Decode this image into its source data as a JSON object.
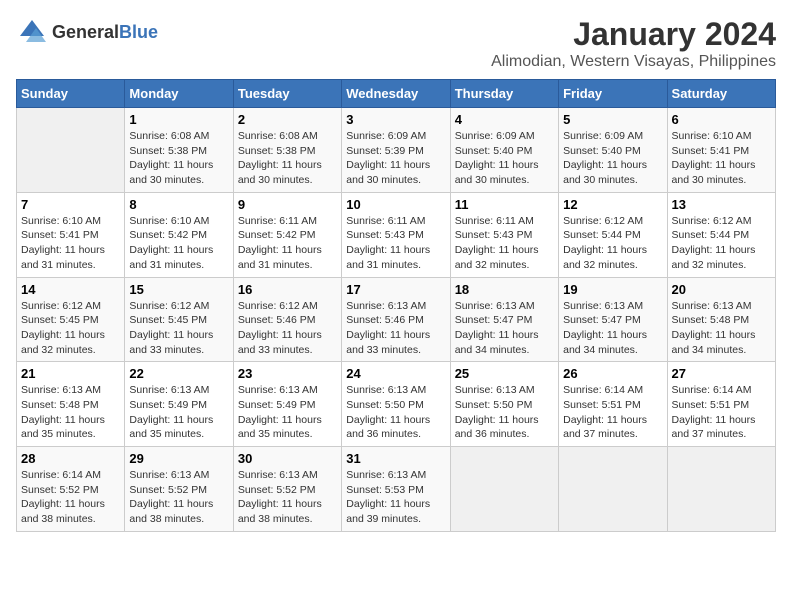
{
  "logo": {
    "general": "General",
    "blue": "Blue"
  },
  "title": "January 2024",
  "subtitle": "Alimodian, Western Visayas, Philippines",
  "days_of_week": [
    "Sunday",
    "Monday",
    "Tuesday",
    "Wednesday",
    "Thursday",
    "Friday",
    "Saturday"
  ],
  "weeks": [
    [
      {
        "day": "",
        "info": ""
      },
      {
        "day": "1",
        "info": "Sunrise: 6:08 AM\nSunset: 5:38 PM\nDaylight: 11 hours\nand 30 minutes."
      },
      {
        "day": "2",
        "info": "Sunrise: 6:08 AM\nSunset: 5:38 PM\nDaylight: 11 hours\nand 30 minutes."
      },
      {
        "day": "3",
        "info": "Sunrise: 6:09 AM\nSunset: 5:39 PM\nDaylight: 11 hours\nand 30 minutes."
      },
      {
        "day": "4",
        "info": "Sunrise: 6:09 AM\nSunset: 5:40 PM\nDaylight: 11 hours\nand 30 minutes."
      },
      {
        "day": "5",
        "info": "Sunrise: 6:09 AM\nSunset: 5:40 PM\nDaylight: 11 hours\nand 30 minutes."
      },
      {
        "day": "6",
        "info": "Sunrise: 6:10 AM\nSunset: 5:41 PM\nDaylight: 11 hours\nand 30 minutes."
      }
    ],
    [
      {
        "day": "7",
        "info": "Sunrise: 6:10 AM\nSunset: 5:41 PM\nDaylight: 11 hours\nand 31 minutes."
      },
      {
        "day": "8",
        "info": "Sunrise: 6:10 AM\nSunset: 5:42 PM\nDaylight: 11 hours\nand 31 minutes."
      },
      {
        "day": "9",
        "info": "Sunrise: 6:11 AM\nSunset: 5:42 PM\nDaylight: 11 hours\nand 31 minutes."
      },
      {
        "day": "10",
        "info": "Sunrise: 6:11 AM\nSunset: 5:43 PM\nDaylight: 11 hours\nand 31 minutes."
      },
      {
        "day": "11",
        "info": "Sunrise: 6:11 AM\nSunset: 5:43 PM\nDaylight: 11 hours\nand 32 minutes."
      },
      {
        "day": "12",
        "info": "Sunrise: 6:12 AM\nSunset: 5:44 PM\nDaylight: 11 hours\nand 32 minutes."
      },
      {
        "day": "13",
        "info": "Sunrise: 6:12 AM\nSunset: 5:44 PM\nDaylight: 11 hours\nand 32 minutes."
      }
    ],
    [
      {
        "day": "14",
        "info": "Sunrise: 6:12 AM\nSunset: 5:45 PM\nDaylight: 11 hours\nand 32 minutes."
      },
      {
        "day": "15",
        "info": "Sunrise: 6:12 AM\nSunset: 5:45 PM\nDaylight: 11 hours\nand 33 minutes."
      },
      {
        "day": "16",
        "info": "Sunrise: 6:12 AM\nSunset: 5:46 PM\nDaylight: 11 hours\nand 33 minutes."
      },
      {
        "day": "17",
        "info": "Sunrise: 6:13 AM\nSunset: 5:46 PM\nDaylight: 11 hours\nand 33 minutes."
      },
      {
        "day": "18",
        "info": "Sunrise: 6:13 AM\nSunset: 5:47 PM\nDaylight: 11 hours\nand 34 minutes."
      },
      {
        "day": "19",
        "info": "Sunrise: 6:13 AM\nSunset: 5:47 PM\nDaylight: 11 hours\nand 34 minutes."
      },
      {
        "day": "20",
        "info": "Sunrise: 6:13 AM\nSunset: 5:48 PM\nDaylight: 11 hours\nand 34 minutes."
      }
    ],
    [
      {
        "day": "21",
        "info": "Sunrise: 6:13 AM\nSunset: 5:48 PM\nDaylight: 11 hours\nand 35 minutes."
      },
      {
        "day": "22",
        "info": "Sunrise: 6:13 AM\nSunset: 5:49 PM\nDaylight: 11 hours\nand 35 minutes."
      },
      {
        "day": "23",
        "info": "Sunrise: 6:13 AM\nSunset: 5:49 PM\nDaylight: 11 hours\nand 35 minutes."
      },
      {
        "day": "24",
        "info": "Sunrise: 6:13 AM\nSunset: 5:50 PM\nDaylight: 11 hours\nand 36 minutes."
      },
      {
        "day": "25",
        "info": "Sunrise: 6:13 AM\nSunset: 5:50 PM\nDaylight: 11 hours\nand 36 minutes."
      },
      {
        "day": "26",
        "info": "Sunrise: 6:14 AM\nSunset: 5:51 PM\nDaylight: 11 hours\nand 37 minutes."
      },
      {
        "day": "27",
        "info": "Sunrise: 6:14 AM\nSunset: 5:51 PM\nDaylight: 11 hours\nand 37 minutes."
      }
    ],
    [
      {
        "day": "28",
        "info": "Sunrise: 6:14 AM\nSunset: 5:52 PM\nDaylight: 11 hours\nand 38 minutes."
      },
      {
        "day": "29",
        "info": "Sunrise: 6:13 AM\nSunset: 5:52 PM\nDaylight: 11 hours\nand 38 minutes."
      },
      {
        "day": "30",
        "info": "Sunrise: 6:13 AM\nSunset: 5:52 PM\nDaylight: 11 hours\nand 38 minutes."
      },
      {
        "day": "31",
        "info": "Sunrise: 6:13 AM\nSunset: 5:53 PM\nDaylight: 11 hours\nand 39 minutes."
      },
      {
        "day": "",
        "info": ""
      },
      {
        "day": "",
        "info": ""
      },
      {
        "day": "",
        "info": ""
      }
    ]
  ]
}
